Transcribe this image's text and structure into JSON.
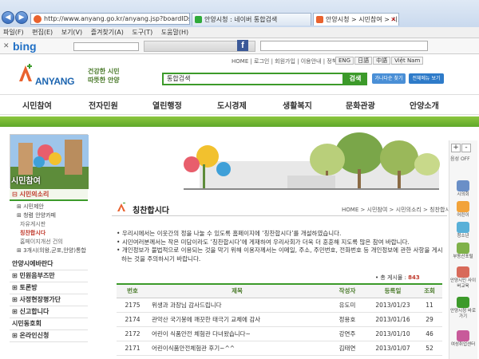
{
  "browser": {
    "url": "http://www.anyang.go.kr/anyang.jsp?boardIDs",
    "tabs": [
      {
        "label": "안양시청 : 네이버 통합검색"
      },
      {
        "label": "안양시청 > 시민참여 > 시..."
      }
    ],
    "menu": [
      "파일(F)",
      "편집(E)",
      "보기(V)",
      "즐겨찾기(A)",
      "도구(T)",
      "도움말(H)"
    ],
    "toolbar_logo": "bing",
    "facebook_icon": "f"
  },
  "site": {
    "util_nav": "HOME | 로그인 | 회원가입 | 이용안내 | 정책실",
    "languages": [
      "ENG",
      "日語",
      "中語",
      "Việt Nam"
    ],
    "logo_text": "ANYANG",
    "slogan_line1": "건강한 시민",
    "slogan_line2": "따뜻한 안양",
    "search": {
      "value": "통합검색",
      "button": "검색"
    },
    "guide_buttons": [
      "가나다순 찾기",
      "전체메뉴 보기"
    ],
    "gnb": [
      "시민참여",
      "전자민원",
      "열린행정",
      "도시경제",
      "생활복지",
      "문화관광",
      "안양소개"
    ]
  },
  "left": {
    "photo_label": "시민참여",
    "section_title": "시민의소리",
    "sub_items": [
      {
        "label": "시민제안",
        "type": "plus"
      },
      {
        "label": "청렴 안양카페",
        "type": "plus"
      },
      {
        "label": "자유게시판",
        "type": "plain"
      },
      {
        "label": "칭찬합시다",
        "type": "current"
      },
      {
        "label": "홈페이지개선 건의",
        "type": "sub"
      },
      {
        "label": "3개시(의왕,군포,안양)통합",
        "type": "plus"
      }
    ],
    "top_items": [
      "안양시에바란다",
      "민원음부즈만",
      "토론방",
      "사정현장평가단",
      "신고합니다",
      "시민동호회",
      "온라인신청"
    ]
  },
  "content": {
    "page_title": "칭찬합시다",
    "breadcrumb": "HOME > 시민참여 > 시민의소리 > 칭찬합시다",
    "notice": [
      "우리시에서는 이웃간의 정을 나눌 수 있도록 홈페이지에 ‘칭찬합시다’를 개설하였습니다.",
      "시민여러분께서는 작은 미담이라도 ‘칭찬합시다’에 게재하여 우리사회가 더욱 더 훈훈해 지도록 많은 참여 바랍니다.",
      "개인정보가 불법적으로 이용되는 것을 막기 위해 이용자께서는 이메일, 주소, 주민번호, 전화번호 등 개인정보에 관한 사항을 게시하는 것을 주의하시기 바랍니다."
    ],
    "count_label": "총 게시물 :",
    "count_value": "843",
    "table": {
      "headers": [
        "번호",
        "제목",
        "작성자",
        "등록일",
        "조회"
      ],
      "rows": [
        [
          "2175",
          "위생과 과장님 감사드립니다",
          "유도미",
          "2013/01/23",
          "11"
        ],
        [
          "2174",
          "관악산 국기봉에 깨끗한 태극기 교체에 감사",
          "정용호",
          "2013/01/16",
          "29"
        ],
        [
          "2172",
          "어린이 식품안전 체험관 다녀왔습니다~",
          "강연주",
          "2013/01/10",
          "46"
        ],
        [
          "2171",
          "어린이식품안전체험관 후기~^^",
          "김태연",
          "2013/01/07",
          "52"
        ]
      ]
    }
  },
  "quick_menu": {
    "font_controls": [
      "+",
      "-"
    ],
    "audio": "음성 OFF",
    "items": [
      "시의회",
      "어린이",
      "청소년",
      "부동산포털",
      "안양시민 사이버교육",
      "안양시청 바로가기",
      "여성취업센터"
    ]
  },
  "colors": {
    "brand_green": "#3c9a2a",
    "brand_blue": "#1d65b0",
    "accent_red": "#c0392b"
  }
}
